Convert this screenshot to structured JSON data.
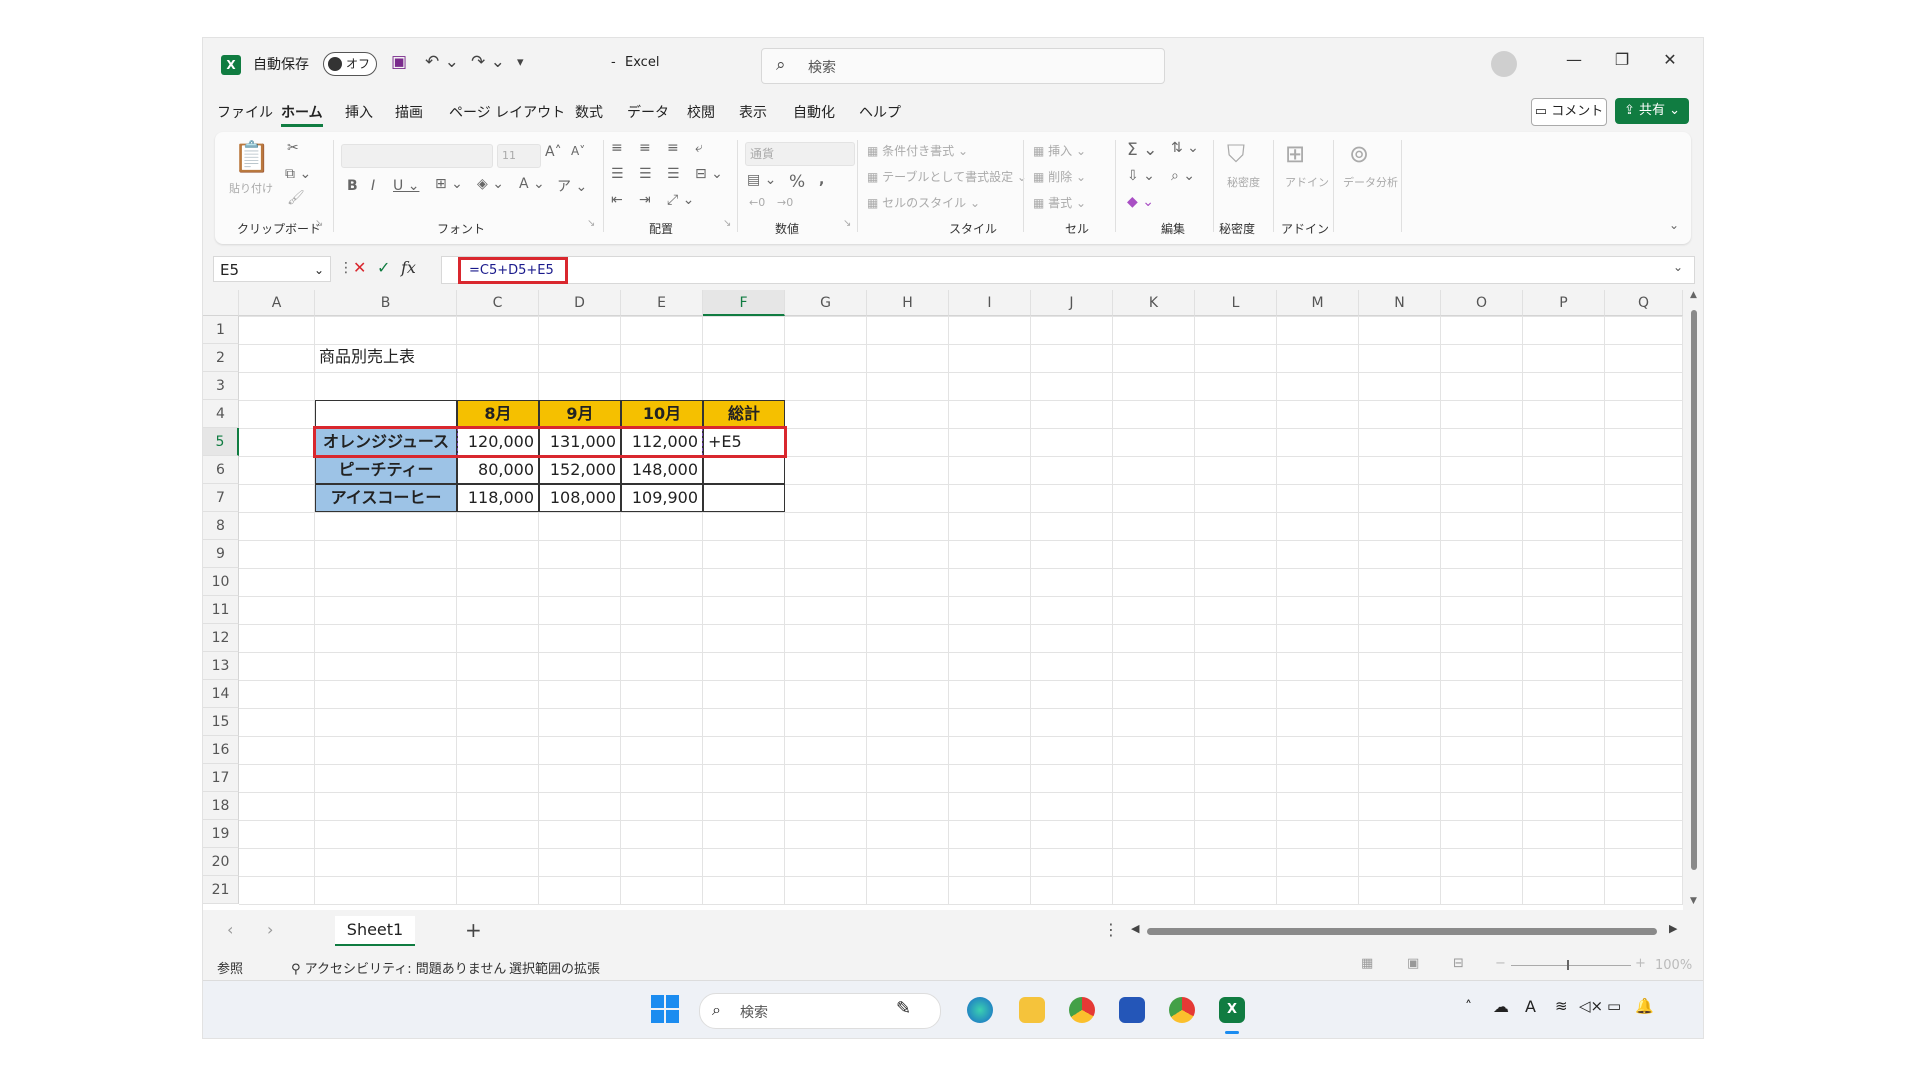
{
  "titlebar": {
    "autosave_label": "自動保存",
    "autosave_state": "オフ",
    "app_title": "Excel",
    "title_prefix": "-",
    "search_placeholder": "検索"
  },
  "menu": {
    "items": [
      "ファイル",
      "ホーム",
      "挿入",
      "描画",
      "ページ レイアウト",
      "数式",
      "データ",
      "校閲",
      "表示",
      "自動化",
      "ヘルプ"
    ],
    "active": "ホーム",
    "comment": "コメント",
    "share": "共有"
  },
  "ribbon": {
    "groups": [
      "クリップボード",
      "フォント",
      "配置",
      "数値",
      "スタイル",
      "セル",
      "編集",
      "秘密度",
      "アドイン"
    ],
    "paste": "貼り付け",
    "font_size": "11",
    "number_format": "通貨",
    "conditional": "条件付き書式",
    "as_table": "テーブルとして書式設定",
    "cell_style": "セルのスタイル",
    "insert": "挿入",
    "delete": "削除",
    "format": "書式",
    "sensitivity": "秘密度",
    "addin": "アドイン",
    "data_analysis": "データ分析"
  },
  "formula_bar": {
    "name_box": "E5",
    "fx": "fx",
    "formula": "=C5+D5+E5"
  },
  "columns": [
    "A",
    "B",
    "C",
    "D",
    "E",
    "F",
    "G",
    "H",
    "I",
    "J",
    "K",
    "L",
    "M",
    "N",
    "O",
    "P",
    "Q"
  ],
  "selected_column": "F",
  "rows": [
    "1",
    "2",
    "3",
    "4",
    "5",
    "6",
    "7",
    "8",
    "9",
    "10",
    "11",
    "12",
    "13",
    "14",
    "15",
    "16",
    "17",
    "18",
    "19",
    "20",
    "21"
  ],
  "selected_row": "5",
  "sheet": {
    "title": "商品別売上表",
    "headers": [
      "8月",
      "9月",
      "10月",
      "総計"
    ],
    "products": [
      {
        "name": "オレンジジュース",
        "values": [
          "120,000",
          "131,000",
          "112,000"
        ],
        "total": "+E5"
      },
      {
        "name": "ピーチティー",
        "values": [
          "80,000",
          "152,000",
          "148,000"
        ],
        "total": ""
      },
      {
        "name": "アイスコーヒー",
        "values": [
          "118,000",
          "108,000",
          "109,900"
        ],
        "total": ""
      }
    ]
  },
  "tabs": {
    "sheet_name": "Sheet1",
    "add": "+"
  },
  "status": {
    "mode": "参照",
    "accessibility": "アクセシビリティ: 問題ありません",
    "extend": "選択範囲の拡張",
    "zoom": "100%"
  },
  "taskbar": {
    "search_placeholder": "検索"
  },
  "colors": {
    "header_fill": "#f5c000",
    "product_fill": "#9dc3e6",
    "highlight_border": "#d9272e",
    "excel_green": "#107c41"
  }
}
